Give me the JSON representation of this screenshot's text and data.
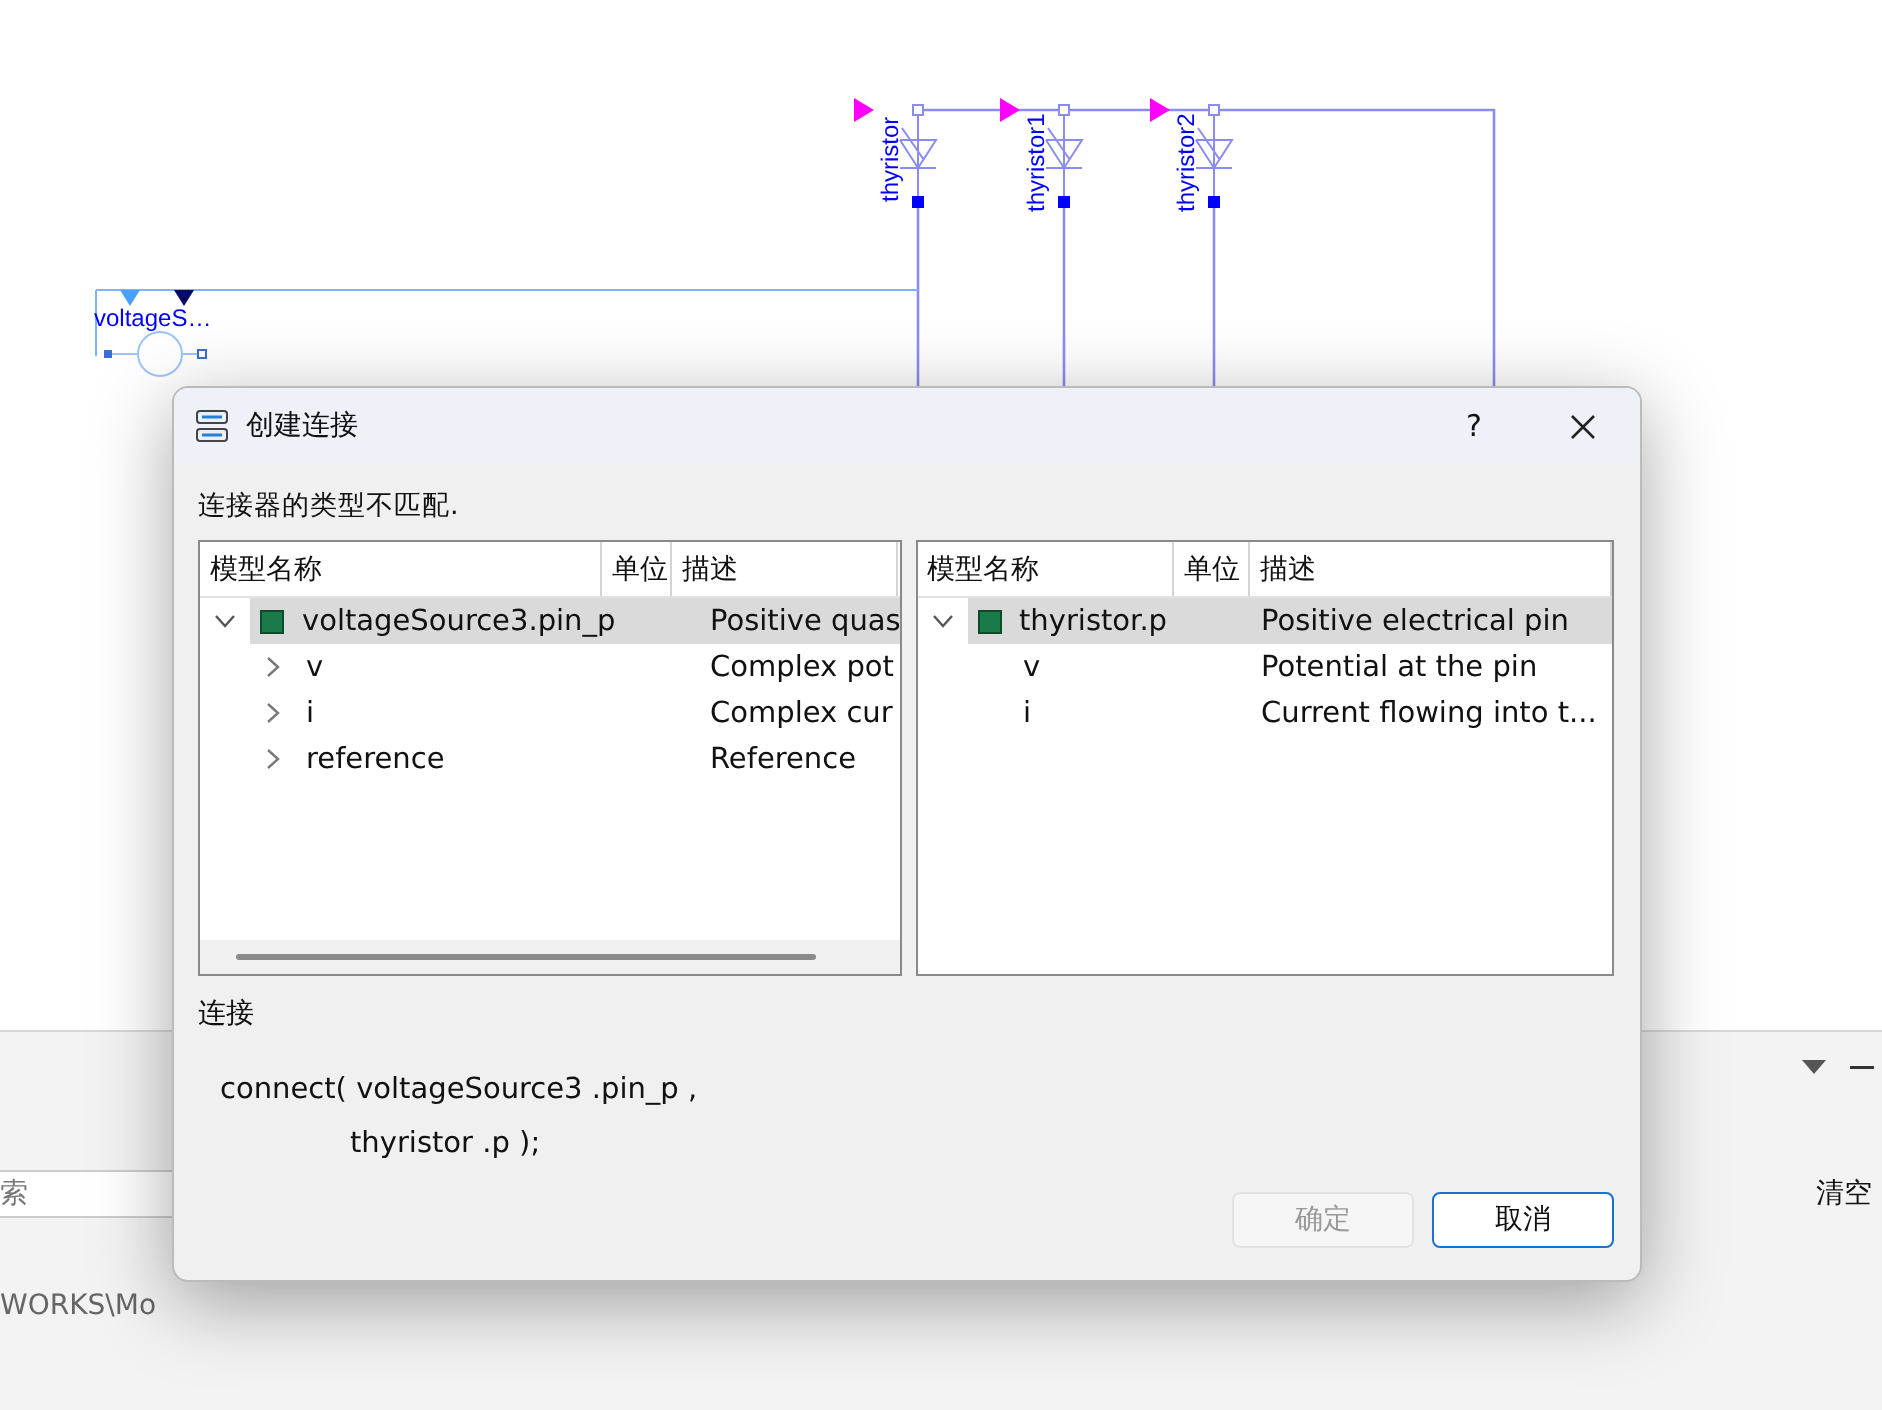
{
  "diagram": {
    "components": [
      {
        "label": "thyristor"
      },
      {
        "label": "thyristor1"
      },
      {
        "label": "thyristor2"
      }
    ],
    "source": {
      "label": "voltageS…"
    }
  },
  "panel": {
    "search": {
      "placeholder": "索"
    },
    "clear_button": "清空",
    "path": "WORKS\\Mo"
  },
  "dialog": {
    "title": "创建连接",
    "help": "?",
    "message": "连接器的类型不匹配.",
    "trees": [
      {
        "columns": [
          "模型名称",
          "单位",
          "描述"
        ],
        "rows": [
          {
            "name": "voltageSource3.pin_p",
            "description": "Positive quas",
            "expanded": true,
            "selected": true,
            "children": [
              {
                "name": "v",
                "description": "Complex pot",
                "expanded": false,
                "selected": false
              },
              {
                "name": "i",
                "description": "Complex cur",
                "expanded": false,
                "selected": false
              },
              {
                "name": "reference",
                "description": "Reference",
                "expanded": false,
                "selected": false
              }
            ]
          }
        ]
      },
      {
        "columns": [
          "模型名称",
          "单位",
          "描述"
        ],
        "rows": [
          {
            "name": "thyristor.p",
            "description": "Positive electrical pin",
            "expanded": true,
            "selected": true,
            "children": [
              {
                "name": "v",
                "description": "Potential at the pin",
                "selected": false
              },
              {
                "name": "i",
                "description": "Current flowing into t...",
                "selected": false
              }
            ]
          }
        ]
      }
    ],
    "connection_label": "连接",
    "code": [
      "connect( voltageSource3 .pin_p ,",
      "thyristor .p );"
    ],
    "buttons": [
      {
        "label": "确定",
        "disabled": true
      },
      {
        "label": "取消",
        "disabled": false
      }
    ]
  }
}
